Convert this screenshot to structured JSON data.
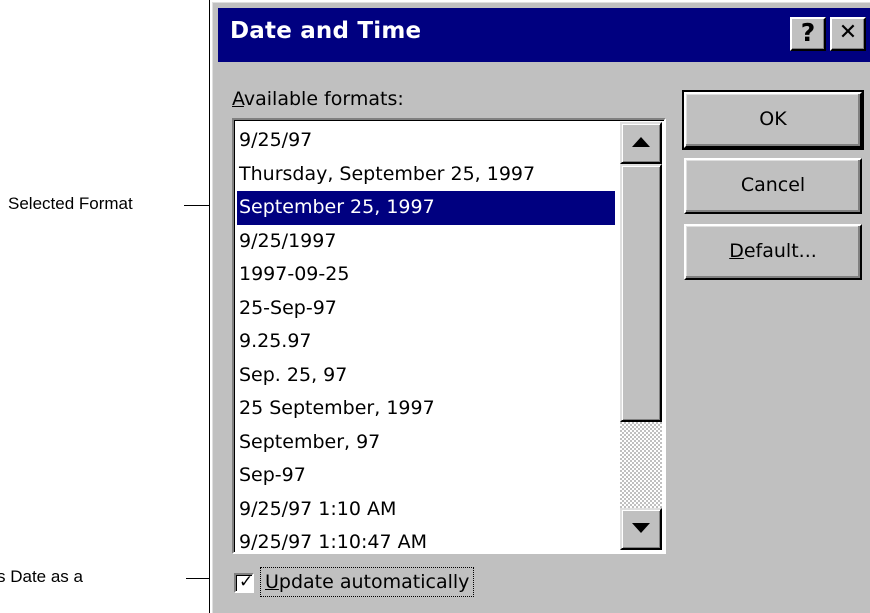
{
  "callouts": {
    "selected_format": "Selected Format",
    "update_prefix": "s Date as a"
  },
  "dialog": {
    "title": "Date and Time",
    "help_glyph": "?",
    "close_glyph": "✕",
    "available_formats_label_mnemonic": "A",
    "available_formats_label_rest": "vailable formats:",
    "formats": [
      "9/25/97",
      "Thursday, September 25, 1997",
      "September 25, 1997",
      "9/25/1997",
      "1997-09-25",
      "25-Sep-97",
      "9.25.97",
      "Sep. 25, 97",
      "25 September, 1997",
      "September, 97",
      "Sep-97",
      "9/25/97 1:10 AM",
      "9/25/97 1:10:47 AM"
    ],
    "selected_index": 2,
    "buttons": {
      "ok": "OK",
      "cancel": "Cancel",
      "default_mnemonic": "D",
      "default_rest": "efault..."
    },
    "update_checkbox": {
      "label_mnemonic": "U",
      "label_rest": "pdate automatically",
      "checked": true
    }
  },
  "colors": {
    "titlebar": "#000080",
    "selection": "#000080",
    "face": "#c0c0c0"
  }
}
